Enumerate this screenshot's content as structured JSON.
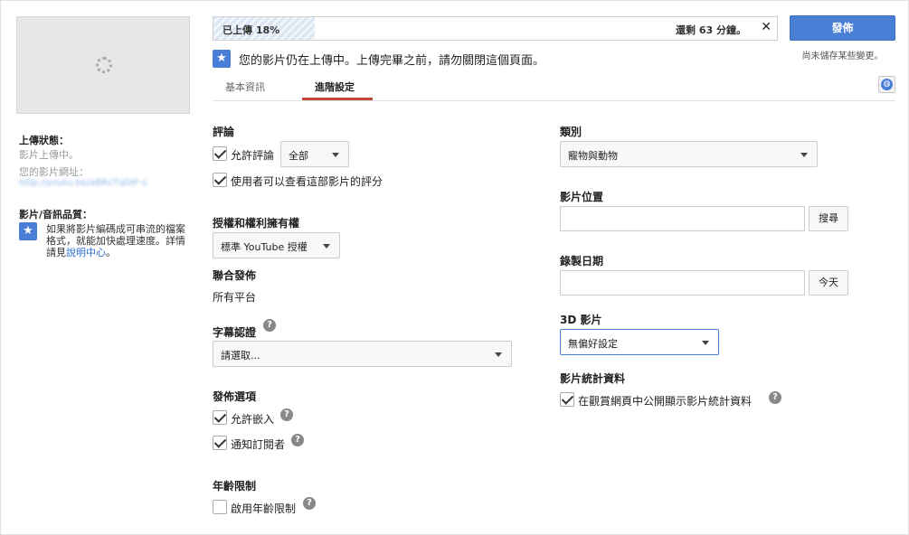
{
  "sidebar": {
    "upload_status_label": "上傳狀態：",
    "upload_status_value": "影片上傳中。",
    "video_url_label": "您的影片網址：",
    "video_url_value": "http://youtu.be/aBRcTqDIF-s",
    "quality_label": "影片/音訊品質：",
    "quality_note": "如果將影片編碼成可串流的檔案格式，就能加快處理速度。詳情請見",
    "quality_link": "說明中心",
    "quality_end": "。"
  },
  "upload": {
    "progress_text": "已上傳 18%",
    "progress_percent": 18,
    "remaining": "還剩 63 分鐘。",
    "close": "✕",
    "notice": "您的影片仍在上傳中。上傳完畢之前，請勿關閉這個頁面。"
  },
  "header": {
    "publish_label": "發佈",
    "unsaved_label": "尚未儲存某些變更。"
  },
  "tabs": [
    {
      "label": "基本資訊"
    },
    {
      "label": "進階設定"
    }
  ],
  "left_col": {
    "comments_title": "評論",
    "allow_comments": "允許評論",
    "comments_select": "全部",
    "view_ratings": "使用者可以查看這部影片的評分",
    "license_title": "授權和權利擁有權",
    "license_select": "標準 YouTube 授權",
    "syndication_title": "聯合發佈",
    "syndication_value": "所有平台",
    "caption_title": "字幕認證",
    "caption_select": "請選取...",
    "distribution_title": "發佈選項",
    "allow_embed": "允許嵌入",
    "notify_subscribers": "通知訂閱者",
    "age_title": "年齡限制",
    "age_restrict": "啟用年齡限制"
  },
  "right_col": {
    "category_title": "類別",
    "category_select": "寵物與動物",
    "location_title": "影片位置",
    "location_value": "",
    "search_btn": "搜尋",
    "date_title": "錄製日期",
    "date_value": "",
    "today_btn": "今天",
    "threed_title": "3D 影片",
    "threed_select": "無偏好設定",
    "stats_title": "影片統計資料",
    "stats_public": "在觀賞網頁中公開顯示影片統計資料"
  },
  "icons": {
    "star": "★",
    "help": "?",
    "globe": "globe-icon"
  },
  "colors": {
    "accent_blue": "#4a7fd6",
    "tab_underline": "#c1483a",
    "link": "#2a6ad3"
  }
}
